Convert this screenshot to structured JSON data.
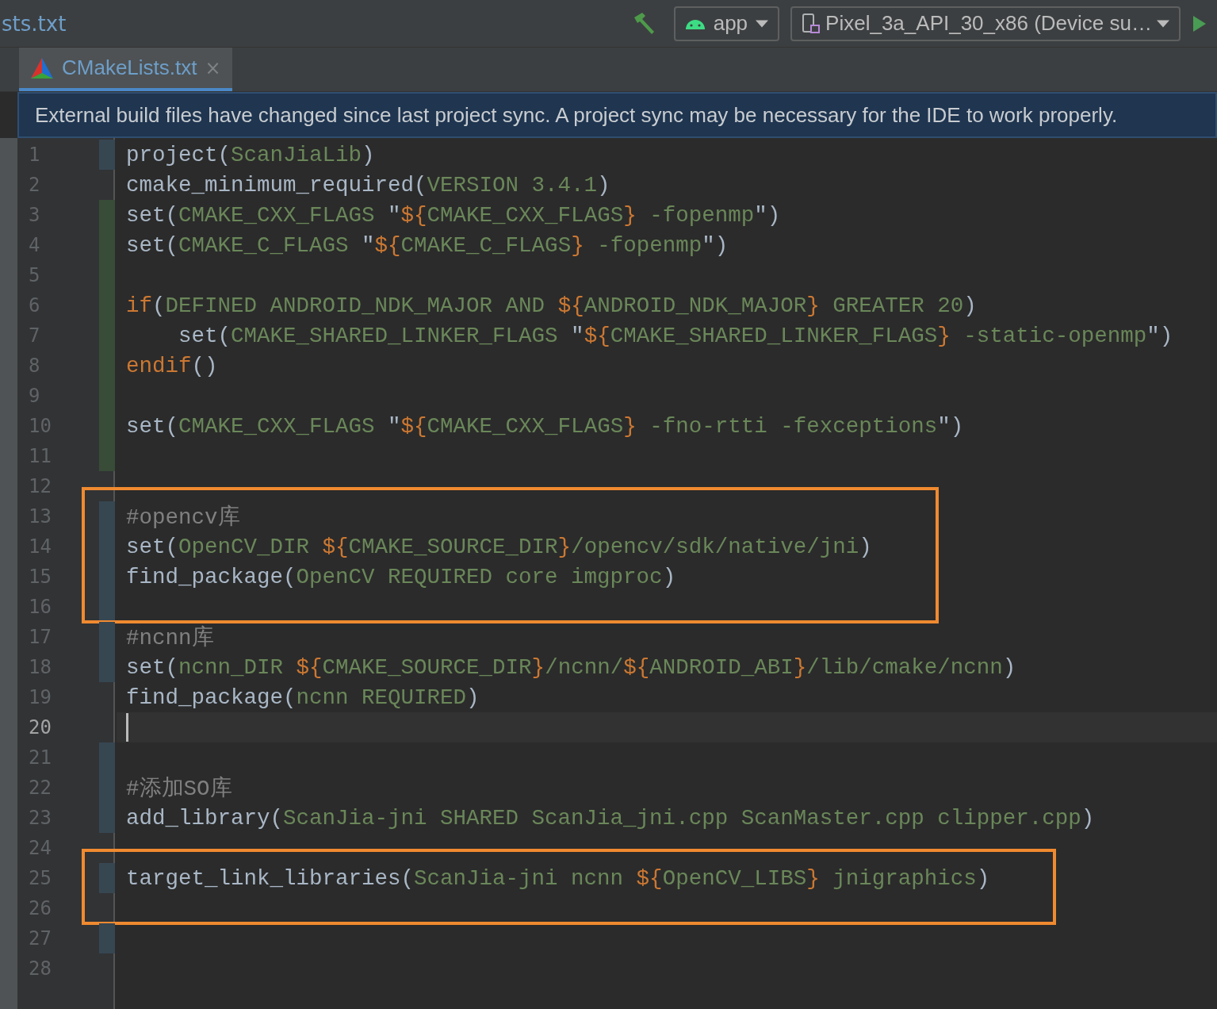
{
  "toolbar": {
    "file_name": "sts.txt",
    "run_config": "app",
    "device": "Pixel_3a_API_30_x86 (Device su…"
  },
  "tabs": [
    {
      "label": "CMakeLists.txt",
      "selected": true,
      "close": "×"
    }
  ],
  "notification": "External build files have changed since last project sync. A project sync may be necessary for the IDE to work properly.",
  "lines": [
    {
      "number": "1",
      "added": false,
      "modified": true,
      "current": false,
      "highlight": false,
      "tokens": [
        {
          "kind": "plain",
          "text": "project("
        },
        {
          "kind": "arg",
          "text": "ScanJiaLib"
        },
        {
          "kind": "plain",
          "text": ")"
        }
      ]
    },
    {
      "number": "2",
      "added": false,
      "modified": false,
      "current": false,
      "highlight": false,
      "tokens": [
        {
          "kind": "plain",
          "text": "cmake_minimum_required("
        },
        {
          "kind": "arg",
          "text": "VERSION 3.4.1"
        },
        {
          "kind": "plain",
          "text": ")"
        }
      ]
    },
    {
      "number": "3",
      "added": true,
      "modified": false,
      "current": false,
      "highlight": false,
      "tokens": [
        {
          "kind": "plain",
          "text": "set("
        },
        {
          "kind": "arg",
          "text": "CMAKE_CXX_FLAGS "
        },
        {
          "kind": "plain",
          "text": "\""
        },
        {
          "kind": "keyword",
          "text": "${"
        },
        {
          "kind": "arg",
          "text": "CMAKE_CXX_FLAGS"
        },
        {
          "kind": "keyword",
          "text": "}"
        },
        {
          "kind": "arg",
          "text": " -fopenmp"
        },
        {
          "kind": "plain",
          "text": "\")"
        }
      ]
    },
    {
      "number": "4",
      "added": true,
      "modified": false,
      "current": false,
      "highlight": false,
      "tokens": [
        {
          "kind": "plain",
          "text": "set("
        },
        {
          "kind": "arg",
          "text": "CMAKE_C_FLAGS "
        },
        {
          "kind": "plain",
          "text": "\""
        },
        {
          "kind": "keyword",
          "text": "${"
        },
        {
          "kind": "arg",
          "text": "CMAKE_C_FLAGS"
        },
        {
          "kind": "keyword",
          "text": "}"
        },
        {
          "kind": "arg",
          "text": " -fopenmp"
        },
        {
          "kind": "plain",
          "text": "\")"
        }
      ]
    },
    {
      "number": "5",
      "added": true,
      "modified": false,
      "current": false,
      "highlight": false
    },
    {
      "number": "6",
      "added": true,
      "modified": false,
      "current": false,
      "highlight": false,
      "tokens": [
        {
          "kind": "keyword",
          "text": "if"
        },
        {
          "kind": "plain",
          "text": "("
        },
        {
          "kind": "arg",
          "text": "DEFINED ANDROID_NDK_MAJOR AND "
        },
        {
          "kind": "keyword",
          "text": "${"
        },
        {
          "kind": "arg",
          "text": "ANDROID_NDK_MAJOR"
        },
        {
          "kind": "keyword",
          "text": "}"
        },
        {
          "kind": "arg",
          "text": " GREATER 20"
        },
        {
          "kind": "plain",
          "text": ")"
        }
      ]
    },
    {
      "number": "7",
      "added": true,
      "modified": false,
      "current": false,
      "highlight": false,
      "tokens": [
        {
          "kind": "plain",
          "text": "    set("
        },
        {
          "kind": "arg",
          "text": "CMAKE_SHARED_LINKER_FLAGS "
        },
        {
          "kind": "plain",
          "text": "\""
        },
        {
          "kind": "keyword",
          "text": "${"
        },
        {
          "kind": "arg",
          "text": "CMAKE_SHARED_LINKER_FLAGS"
        },
        {
          "kind": "keyword",
          "text": "}"
        },
        {
          "kind": "arg",
          "text": " -static-openmp"
        },
        {
          "kind": "plain",
          "text": "\")"
        }
      ]
    },
    {
      "number": "8",
      "added": true,
      "modified": false,
      "current": false,
      "highlight": false,
      "tokens": [
        {
          "kind": "keyword",
          "text": "endif"
        },
        {
          "kind": "plain",
          "text": "()"
        }
      ]
    },
    {
      "number": "9",
      "added": true,
      "modified": false,
      "current": false,
      "highlight": false
    },
    {
      "number": "10",
      "added": true,
      "modified": false,
      "current": false,
      "highlight": false,
      "tokens": [
        {
          "kind": "plain",
          "text": "set("
        },
        {
          "kind": "arg",
          "text": "CMAKE_CXX_FLAGS "
        },
        {
          "kind": "plain",
          "text": "\""
        },
        {
          "kind": "keyword",
          "text": "${"
        },
        {
          "kind": "arg",
          "text": "CMAKE_CXX_FLAGS"
        },
        {
          "kind": "keyword",
          "text": "}"
        },
        {
          "kind": "arg",
          "text": " -fno-rtti -fexceptions"
        },
        {
          "kind": "plain",
          "text": "\")"
        }
      ]
    },
    {
      "number": "11",
      "added": true,
      "modified": false,
      "current": false,
      "highlight": false
    },
    {
      "number": "12",
      "added": false,
      "modified": false,
      "current": false,
      "highlight": false
    },
    {
      "number": "13",
      "added": false,
      "modified": true,
      "current": false,
      "highlight": true,
      "tokens": [
        {
          "kind": "comment",
          "text": "#opencv库"
        }
      ]
    },
    {
      "number": "14",
      "added": false,
      "modified": true,
      "current": false,
      "highlight": true,
      "tokens": [
        {
          "kind": "plain",
          "text": "set("
        },
        {
          "kind": "arg",
          "text": "OpenCV_DIR "
        },
        {
          "kind": "keyword",
          "text": "${"
        },
        {
          "kind": "arg",
          "text": "CMAKE_SOURCE_DIR"
        },
        {
          "kind": "keyword",
          "text": "}"
        },
        {
          "kind": "arg",
          "text": "/opencv/sdk/native/jni"
        },
        {
          "kind": "plain",
          "text": ")"
        }
      ]
    },
    {
      "number": "15",
      "added": false,
      "modified": true,
      "current": false,
      "highlight": true,
      "tokens": [
        {
          "kind": "plain",
          "text": "find_package("
        },
        {
          "kind": "arg",
          "text": "OpenCV REQUIRED core imgproc"
        },
        {
          "kind": "plain",
          "text": ")"
        }
      ]
    },
    {
      "number": "16",
      "added": false,
      "modified": true,
      "current": false,
      "highlight": true
    },
    {
      "number": "17",
      "added": false,
      "modified": true,
      "current": false,
      "highlight": false,
      "tokens": [
        {
          "kind": "comment",
          "text": "#ncnn库"
        }
      ]
    },
    {
      "number": "18",
      "added": false,
      "modified": true,
      "current": false,
      "highlight": false,
      "tokens": [
        {
          "kind": "plain",
          "text": "set("
        },
        {
          "kind": "arg",
          "text": "ncnn_DIR "
        },
        {
          "kind": "keyword",
          "text": "${"
        },
        {
          "kind": "arg",
          "text": "CMAKE_SOURCE_DIR"
        },
        {
          "kind": "keyword",
          "text": "}"
        },
        {
          "kind": "arg",
          "text": "/ncnn/"
        },
        {
          "kind": "keyword",
          "text": "${"
        },
        {
          "kind": "arg",
          "text": "ANDROID_ABI"
        },
        {
          "kind": "keyword",
          "text": "}"
        },
        {
          "kind": "arg",
          "text": "/lib/cmake/ncnn"
        },
        {
          "kind": "plain",
          "text": ")"
        }
      ]
    },
    {
      "number": "19",
      "added": false,
      "modified": false,
      "current": false,
      "highlight": false,
      "tokens": [
        {
          "kind": "plain",
          "text": "find_package("
        },
        {
          "kind": "arg",
          "text": "ncnn REQUIRED"
        },
        {
          "kind": "plain",
          "text": ")"
        }
      ]
    },
    {
      "number": "20",
      "added": false,
      "modified": false,
      "current": true,
      "highlight": false
    },
    {
      "number": "21",
      "added": false,
      "modified": true,
      "current": false,
      "highlight": false
    },
    {
      "number": "22",
      "added": false,
      "modified": true,
      "current": false,
      "highlight": false,
      "tokens": [
        {
          "kind": "comment",
          "text": "#添加SO库"
        }
      ]
    },
    {
      "number": "23",
      "added": false,
      "modified": true,
      "current": false,
      "highlight": false,
      "tokens": [
        {
          "kind": "plain",
          "text": "add_library("
        },
        {
          "kind": "arg",
          "text": "ScanJia-jni SHARED ScanJia_jni.cpp ScanMaster.cpp clipper.cpp"
        },
        {
          "kind": "plain",
          "text": ")"
        }
      ]
    },
    {
      "number": "24",
      "added": false,
      "modified": false,
      "current": false,
      "highlight": false
    },
    {
      "number": "25",
      "added": false,
      "modified": true,
      "current": false,
      "highlight": true,
      "tokens": [
        {
          "kind": "plain",
          "text": "target_link_libraries("
        },
        {
          "kind": "arg",
          "text": "ScanJia-jni ncnn "
        },
        {
          "kind": "keyword",
          "text": "${"
        },
        {
          "kind": "arg",
          "text": "OpenCV_LIBS"
        },
        {
          "kind": "keyword",
          "text": "}"
        },
        {
          "kind": "arg",
          "text": " jnigraphics"
        },
        {
          "kind": "plain",
          "text": ")"
        }
      ]
    },
    {
      "number": "26",
      "added": false,
      "modified": false,
      "current": false,
      "highlight": true
    },
    {
      "number": "27",
      "added": false,
      "modified": true,
      "current": false,
      "highlight": false
    },
    {
      "number": "28",
      "added": false,
      "modified": false,
      "current": false,
      "highlight": false
    }
  ]
}
